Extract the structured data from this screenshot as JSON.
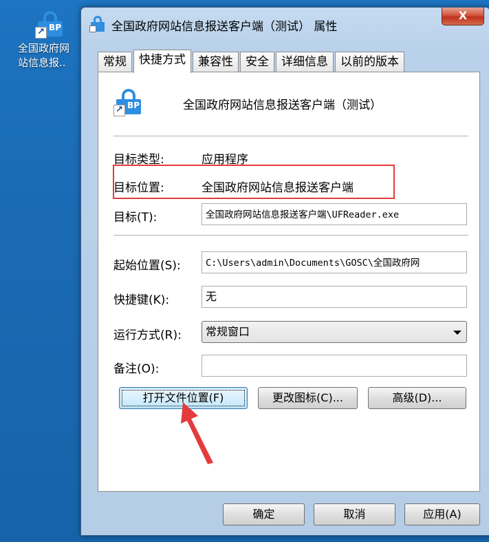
{
  "desktop": {
    "icon_label_line1": "全国政府网",
    "icon_label_line2": "站信息报.."
  },
  "window": {
    "title": "全国政府网站信息报送客户端（测试） 属性",
    "close_label": "X"
  },
  "tabs": [
    {
      "label": "常规",
      "active": false
    },
    {
      "label": "快捷方式",
      "active": true
    },
    {
      "label": "兼容性",
      "active": false
    },
    {
      "label": "安全",
      "active": false
    },
    {
      "label": "详细信息",
      "active": false
    },
    {
      "label": "以前的版本",
      "active": false
    }
  ],
  "shortcut": {
    "name": "全国政府网站信息报送客户端（测试）",
    "target_type_label": "目标类型:",
    "target_type_value": "应用程序",
    "target_location_label": "目标位置:",
    "target_location_value": "全国政府网站信息报送客户端",
    "target_label": "目标(T):",
    "target_value": "全国政府网站信息报送客户端\\UFReader.exe",
    "start_in_label": "起始位置(S):",
    "start_in_value": "C:\\Users\\admin\\Documents\\GOSC\\全国政府网",
    "hotkey_label": "快捷键(K):",
    "hotkey_value": "无",
    "run_label": "运行方式(R):",
    "run_value": "常规窗口",
    "comment_label": "备注(O):",
    "comment_value": "",
    "open_location_button": "打开文件位置(F)",
    "change_icon_button": "更改图标(C)...",
    "advanced_button": "高级(D)..."
  },
  "footer": {
    "ok": "确定",
    "cancel": "取消",
    "apply": "应用(A)"
  },
  "icon_text": {
    "bp": "BP",
    "arrow": "↗"
  },
  "colors": {
    "desktop": "#1a6ab4",
    "app_icon": "#2e8fe0",
    "annotation": "#e43b3b"
  }
}
